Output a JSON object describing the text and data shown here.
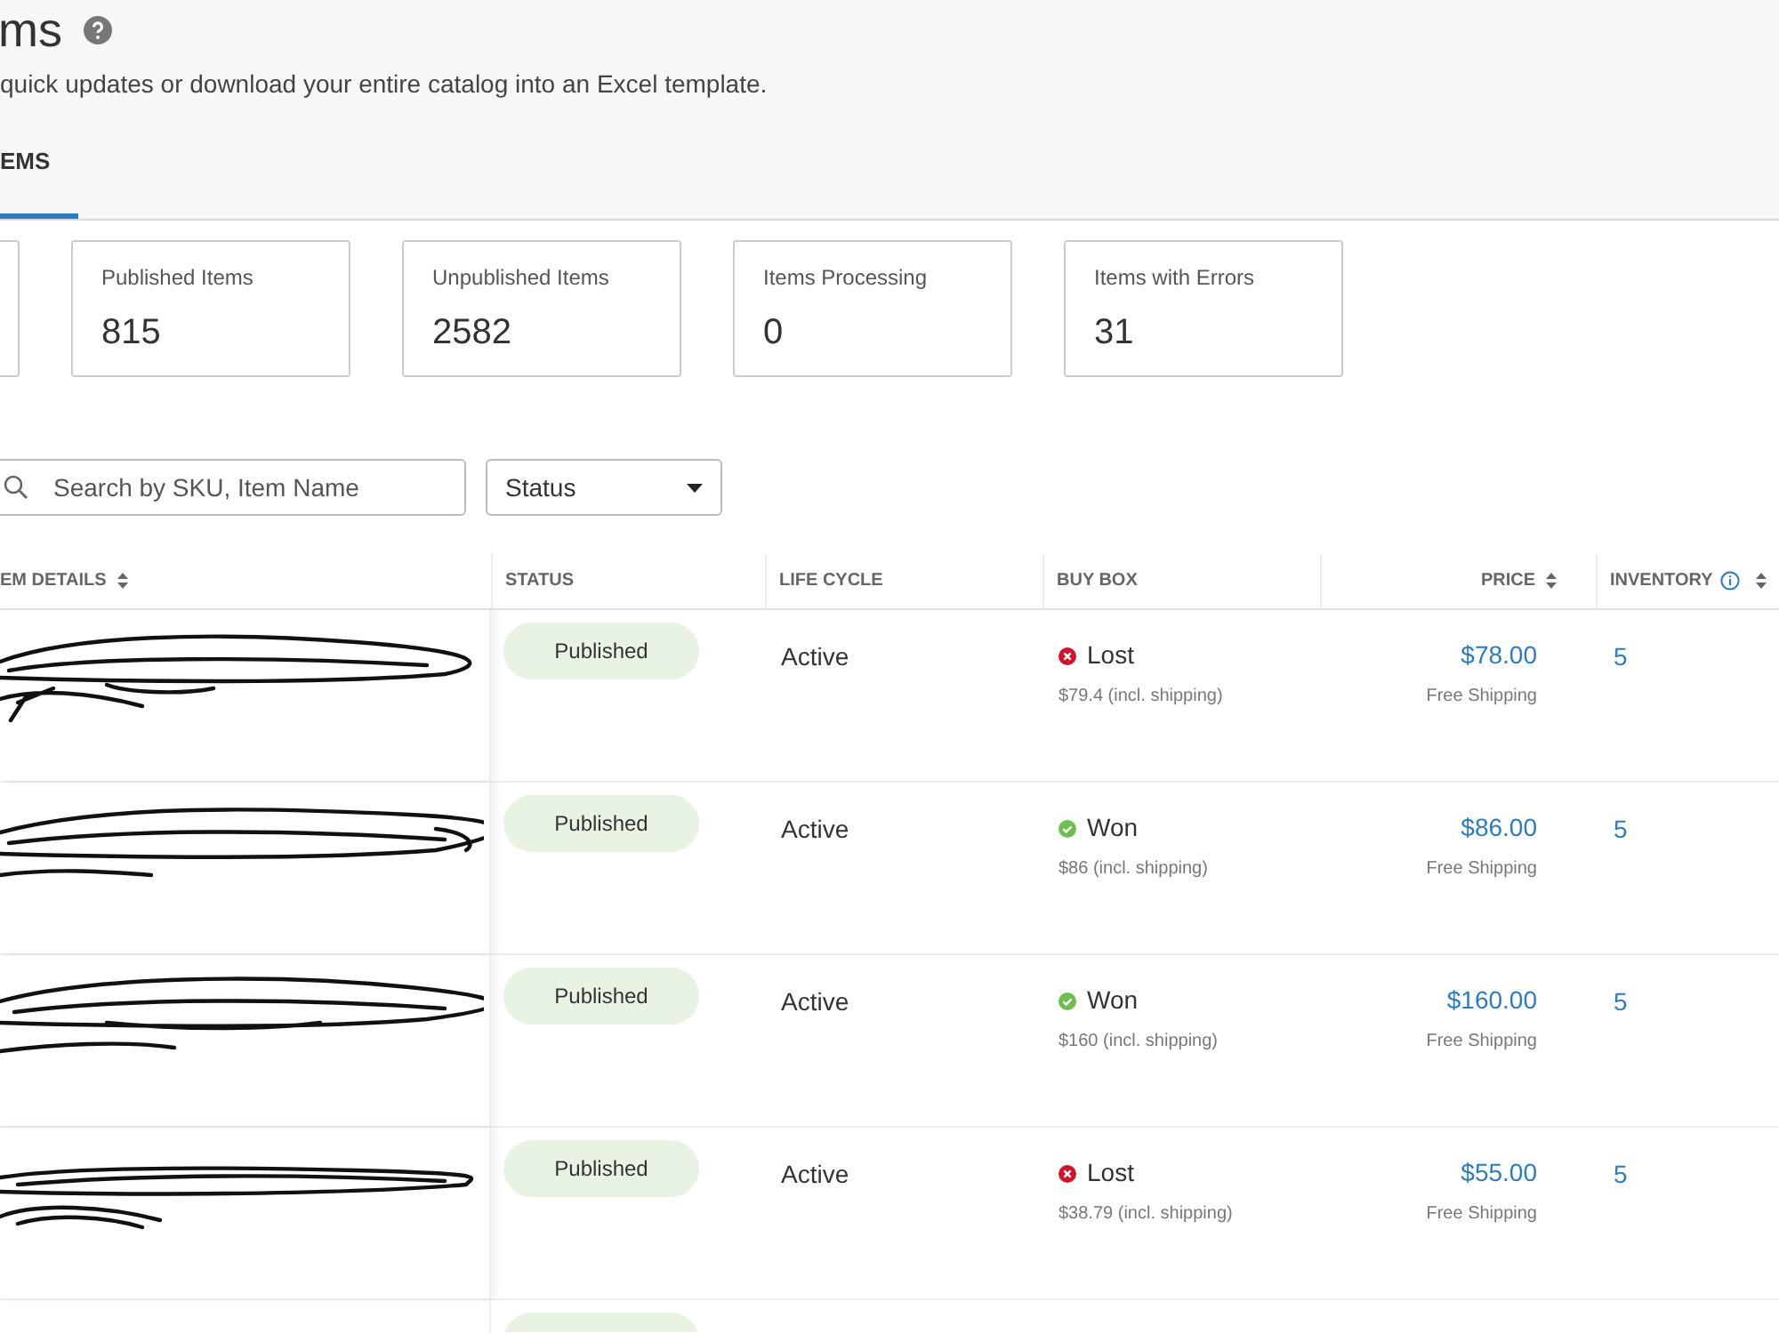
{
  "header": {
    "title": "ms",
    "subtitle": "quick updates or download your entire catalog into an Excel template."
  },
  "tabs": [
    {
      "label": "EMS",
      "selected": true
    }
  ],
  "summary_cards": [
    {
      "kind": "clipped"
    },
    {
      "kind": "stat",
      "label": "Published Items",
      "value": "815"
    },
    {
      "kind": "stat",
      "label": "Unpublished Items",
      "value": "2582"
    },
    {
      "kind": "stat",
      "label": "Items Processing",
      "value": "0"
    },
    {
      "kind": "stat",
      "label": "Items with Errors",
      "value": "31"
    }
  ],
  "search": {
    "placeholder": "Search by SKU, Item Name"
  },
  "status_filter": {
    "value": "Status"
  },
  "table": {
    "columns": [
      {
        "label": "EM DETAILS",
        "sortable": true,
        "info": false
      },
      {
        "label": "STATUS",
        "sortable": false,
        "info": false
      },
      {
        "label": "LIFE CYCLE",
        "sortable": false,
        "info": false
      },
      {
        "label": "BUY BOX",
        "sortable": false,
        "info": false
      },
      {
        "label": "PRICE",
        "sortable": true,
        "info": false
      },
      {
        "label": "INVENTORY",
        "sortable": true,
        "info": true
      }
    ],
    "rows": [
      {
        "status": "Published",
        "life_cycle": "Active",
        "buy_box": {
          "kind": "lost",
          "result": "Lost",
          "note": "$79.4 (incl. shipping)"
        },
        "price": "$78.00",
        "shipping": "Free Shipping",
        "inventory": "5"
      },
      {
        "status": "Published",
        "life_cycle": "Active",
        "buy_box": {
          "kind": "won",
          "result": "Won",
          "note": "$86 (incl. shipping)"
        },
        "price": "$86.00",
        "shipping": "Free Shipping",
        "inventory": "5"
      },
      {
        "status": "Published",
        "life_cycle": "Active",
        "buy_box": {
          "kind": "won",
          "result": "Won",
          "note": "$160 (incl. shipping)"
        },
        "price": "$160.00",
        "shipping": "Free Shipping",
        "inventory": "5"
      },
      {
        "status": "Published",
        "life_cycle": "Active",
        "buy_box": {
          "kind": "lost",
          "result": "Lost",
          "note": "$38.79 (incl. shipping)"
        },
        "price": "$55.00",
        "shipping": "Free Shipping",
        "inventory": "5"
      }
    ]
  }
}
